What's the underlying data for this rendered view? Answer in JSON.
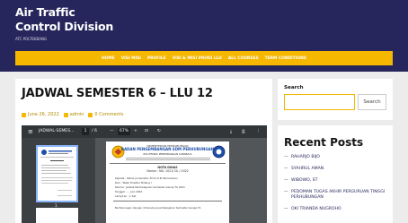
{
  "site": {
    "title_line1": "Air Traffic",
    "title_line2": "Control Division",
    "tagline": "ATC POLTEKBANG"
  },
  "nav": {
    "items": [
      "HOME",
      "VISI MISI",
      "PROFILE",
      "VISI & MISI PRODI LLU",
      "ALL COURSES",
      "TERM CONDITIONS"
    ]
  },
  "post": {
    "title": "JADWAL SEMESTER 6 – LLU 12",
    "date": "June 26, 2022",
    "author": "admin",
    "comments": "0 Comments"
  },
  "pdf_viewer": {
    "menu_icon": "≡",
    "filename": "JADWAL-SEMES...",
    "page_current": "1",
    "page_total": "/ 6",
    "zoom_out": "—",
    "zoom": "67%",
    "zoom_in": "+",
    "fit_icon": "⊡",
    "rotate_icon": "↻",
    "download_icon": "⤓",
    "print_icon": "⎙",
    "more_icon": "⋮",
    "thumb_page_num": "1",
    "doc": {
      "header1": "KEMENTERIAN PERHUBUNGAN",
      "header2": "BADAN PENGEMBANGAN SDM PERHUBUNGAN",
      "header3": "POLITEKNIK PENERBANGAN SURABAYA",
      "memo_title": "NOTA DINAS",
      "memo_number": "Nomor : ND. 1021/ DL / 2022",
      "to": "Kepada : Ketua Jurusan/Ka. Prodi D-III Pemanduan",
      "from": "Dari : Wakil Direktur Bidang I",
      "subject": "Perihal : Jadwal Pembelajaran Semester Genap TA 2021",
      "date": "Tanggal : ... Juni 2022",
      "attach": "Lampiran : 1 Set",
      "body": "Berhubungan dengan dimulainya pembelajaran Semester Genap TA"
    }
  },
  "search": {
    "label": "Search",
    "placeholder": "",
    "button": "Search"
  },
  "recent": {
    "title": "Recent Posts",
    "posts": [
      "RAHARJO BIJO",
      "SYAHRUL AMAN",
      "WIBOWO, ST",
      "PEDOMAN TUGAS AKHIR PERGURUAN TINGGI PERHUBUNGAN",
      "OKI TRIANDA NUGROHO"
    ]
  }
}
